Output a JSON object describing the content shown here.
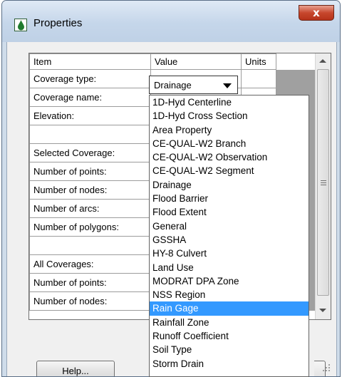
{
  "window": {
    "title": "Properties",
    "close_glyph": "x",
    "icon": "drop-icon"
  },
  "grid": {
    "headers": {
      "item": "Item",
      "value": "Value",
      "units": "Units"
    },
    "rows": [
      {
        "item": "Coverage type:"
      },
      {
        "item": "Coverage name:"
      },
      {
        "item": "Elevation:"
      },
      {
        "item": ""
      },
      {
        "item": "Selected Coverage:"
      },
      {
        "item": "Number of points:"
      },
      {
        "item": "Number of nodes:"
      },
      {
        "item": "Number of arcs:"
      },
      {
        "item": "Number of polygons:"
      },
      {
        "item": ""
      },
      {
        "item": "All Coverages:"
      },
      {
        "item": "Number of points:"
      },
      {
        "item": "Number of nodes:"
      }
    ]
  },
  "dropdown": {
    "selected_value": "Drainage",
    "highlighted": "Rain Gage",
    "options": [
      "1D-Hyd Centerline",
      "1D-Hyd Cross Section",
      "Area Property",
      "CE-QUAL-W2 Branch",
      "CE-QUAL-W2 Observation",
      "CE-QUAL-W2 Segment",
      "Drainage",
      "Flood Barrier",
      "Flood Extent",
      "General",
      "GSSHA",
      "HY-8 Culvert",
      "Land Use",
      "MODRAT DPA Zone",
      "NSS Region",
      "Rain Gage",
      "Rainfall Zone",
      "Runoff Coefficient",
      "Soil Type",
      "Storm Drain"
    ]
  },
  "buttons": {
    "help": "Help..."
  },
  "colors": {
    "selection": "#3399ff",
    "title_bar": "#cfdcea",
    "close": "#c7472d"
  }
}
